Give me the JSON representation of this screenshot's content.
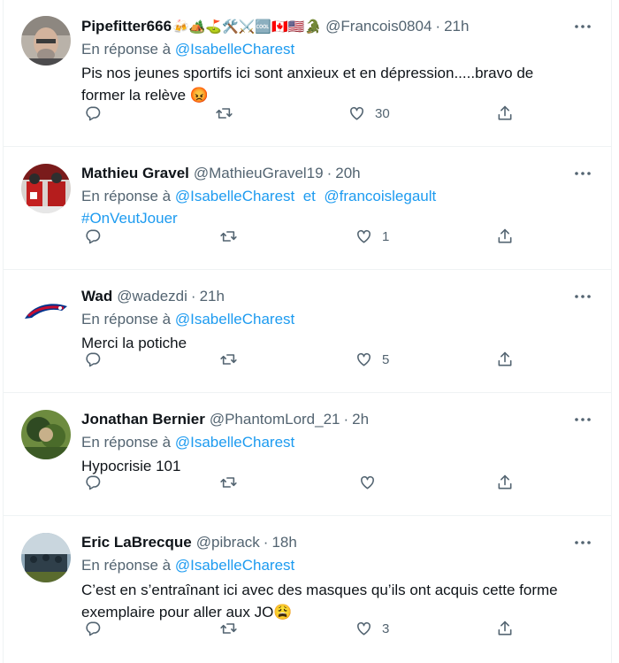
{
  "colors": {
    "link": "#1d9bf0",
    "muted": "#536471",
    "text": "#0f1419",
    "divider": "#eff3f4"
  },
  "tweets": [
    {
      "name": "Pipefitter666",
      "name_emojis": "🍻🏕️⛳🛠️⚔️🆒🇨🇦🇺🇸🐊",
      "handle": "@Francois0804",
      "time": "21h",
      "reply_prefix": "En réponse à",
      "mentions": [
        "@IsabelleCharest"
      ],
      "text_line1": "Pis nos jeunes sportifs ici sont anxieux et en dépression.....bravo de",
      "text_line2": "former la relève",
      "text_emoji": "😡",
      "likes": "30"
    },
    {
      "name": "Mathieu Gravel",
      "handle": "@MathieuGravel19",
      "time": "20h",
      "reply_prefix": "En réponse à",
      "mentions": [
        "@IsabelleCharest",
        "@francoislegault"
      ],
      "mention_joiner": "et",
      "hashtag": "#OnVeutJouer",
      "likes": "1"
    },
    {
      "name": "Wad",
      "handle": "@wadezdi",
      "time": "21h",
      "reply_prefix": "En réponse à",
      "mentions": [
        "@IsabelleCharest"
      ],
      "text_line1": "Merci la potiche",
      "likes": "5"
    },
    {
      "name": "Jonathan Bernier",
      "handle": "@PhantomLord_21",
      "time": "2h",
      "reply_prefix": "En réponse à",
      "mentions": [
        "@IsabelleCharest"
      ],
      "text_line1": "Hypocrisie 101",
      "likes": ""
    },
    {
      "name": "Eric LaBrecque",
      "handle": "@pibrack",
      "time": "18h",
      "reply_prefix": "En réponse à",
      "mentions": [
        "@IsabelleCharest"
      ],
      "text_line1": "C’est en s’entraînant ici avec des masques qu’ils ont acquis cette forme",
      "text_line2": "exemplaire pour aller aux JO",
      "text_emoji": "😩",
      "likes": "3"
    }
  ],
  "icons": {
    "reply": "reply-icon",
    "retweet": "retweet-icon",
    "like": "like-icon",
    "share": "share-icon",
    "more": "more-icon"
  }
}
